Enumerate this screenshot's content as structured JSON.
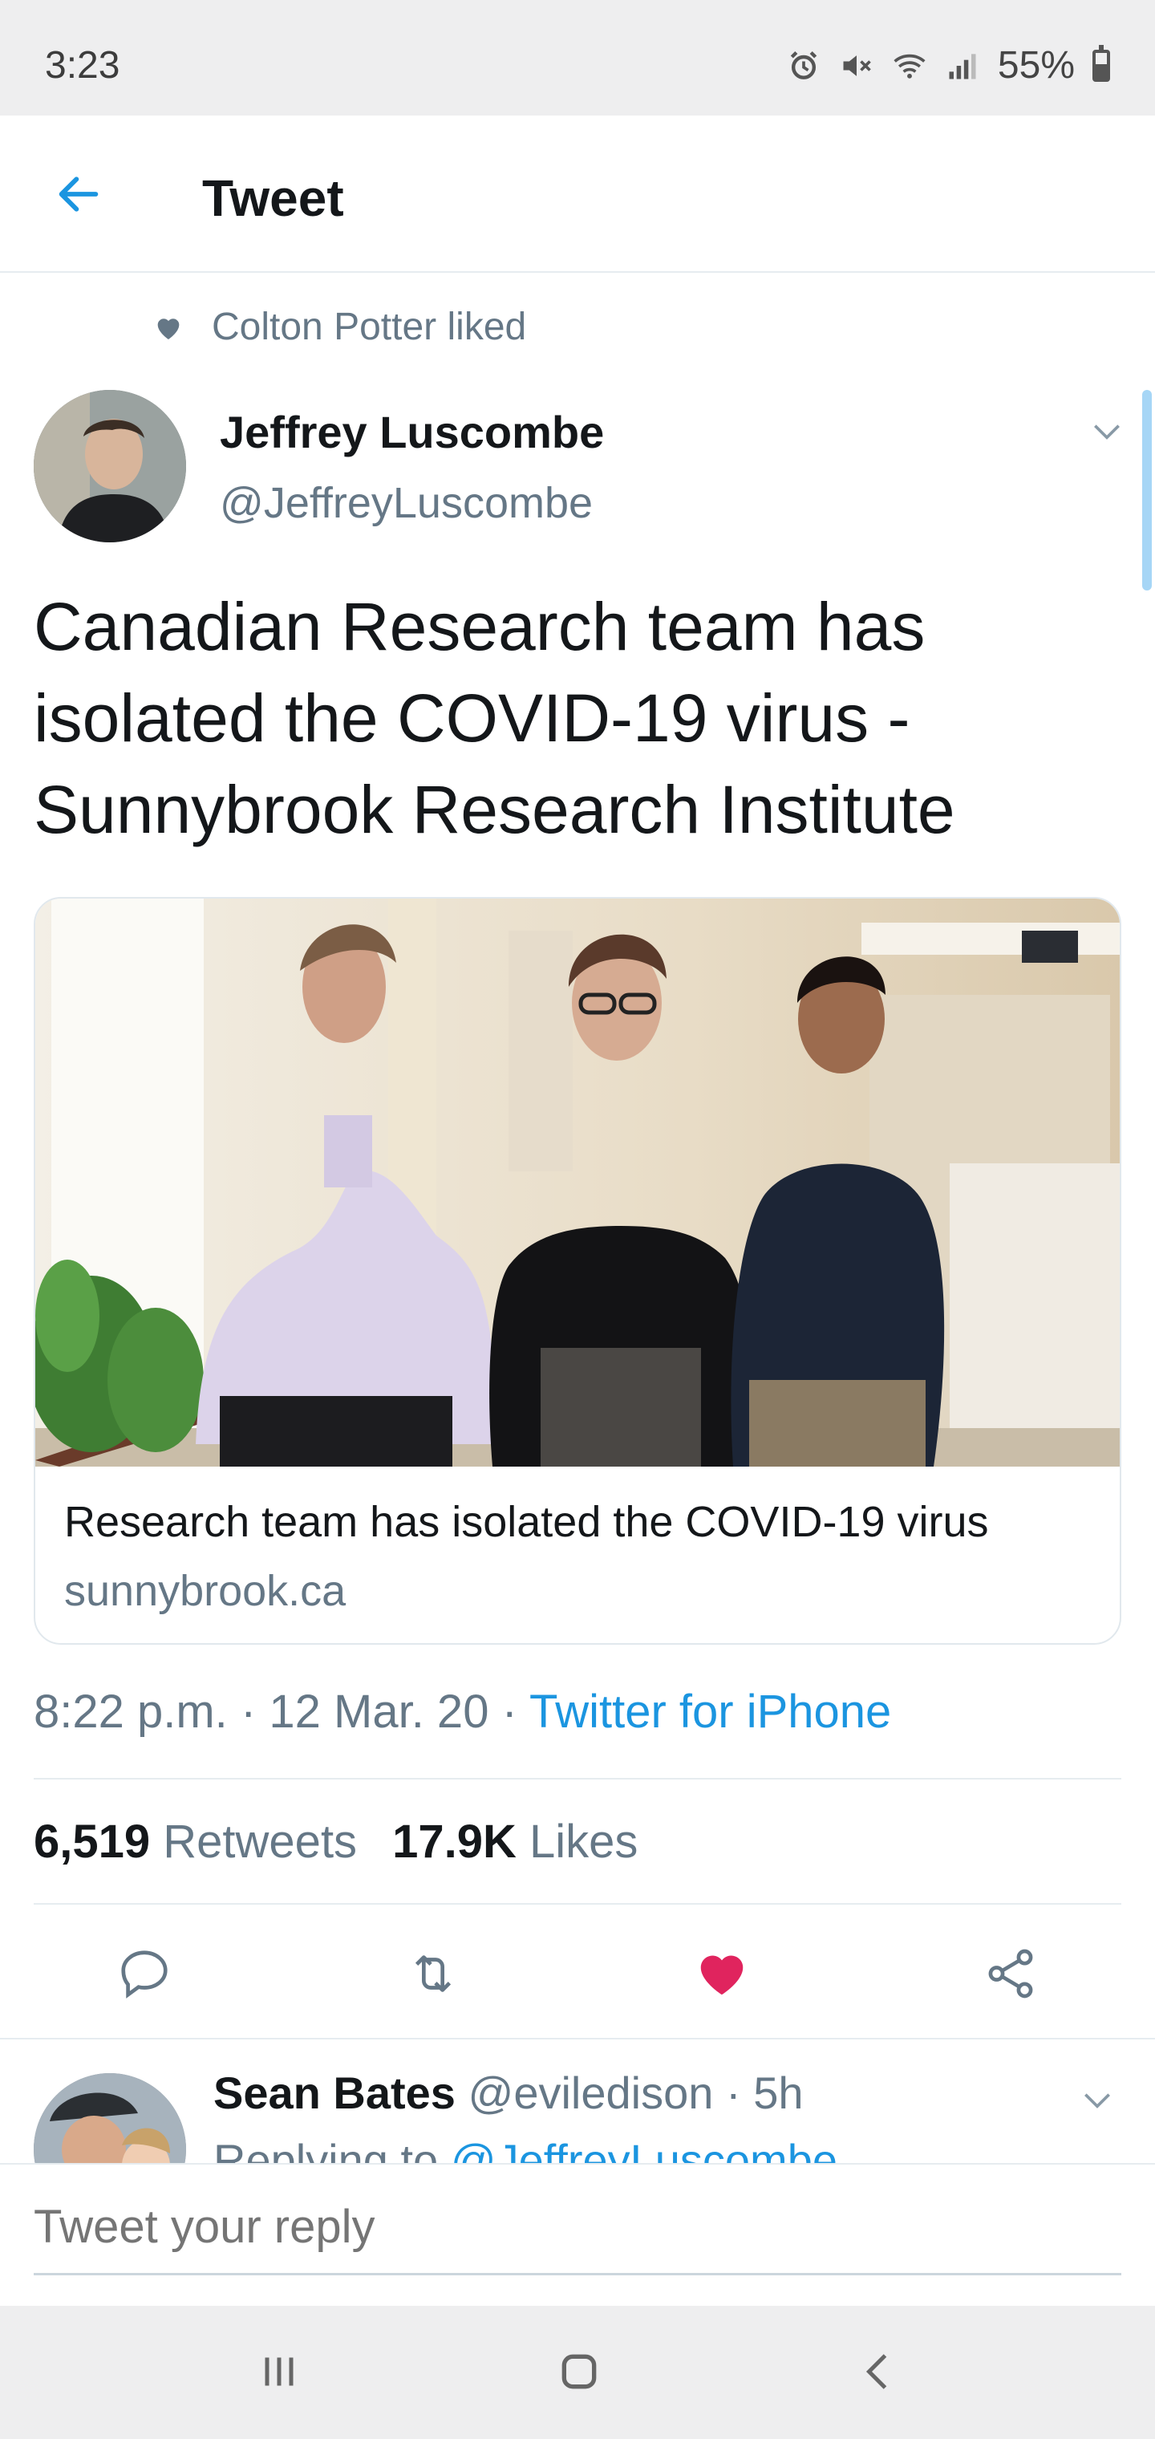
{
  "status_bar": {
    "time": "3:23",
    "battery": "55%",
    "battery_level": 0.55,
    "icons": [
      "alarm-icon",
      "mute-icon",
      "wifi-icon",
      "signal-icon",
      "battery-icon"
    ]
  },
  "header": {
    "title": "Tweet",
    "back_icon": "arrow-left-icon"
  },
  "social_context": {
    "text": "Colton Potter liked",
    "icon": "heart-icon"
  },
  "tweet": {
    "author_name": "Jeffrey Luscombe",
    "author_handle": "@JeffreyLuscombe",
    "text": "Canadian Research team has isolated the COVID-19 virus - Sunnybrook Research Institute",
    "card": {
      "title": "Research team has isolated the COVID-19 virus",
      "domain": "sunnybrook.ca"
    },
    "time": "8:22 p.m.",
    "date": "12 Mar. 20",
    "source": "Twitter for iPhone",
    "retweets_count": "6,519",
    "retweets_label": "Retweets",
    "likes_count": "17.9K",
    "likes_label": "Likes",
    "liked": true
  },
  "reply": {
    "author_name": "Sean Bates",
    "author_handle": "@eviledison",
    "age": "5h",
    "replying_prefix": "Replying to",
    "replying_to": "@JeffreyLuscombe"
  },
  "composer": {
    "placeholder": "Tweet your reply"
  },
  "colors": {
    "accent": "#1b95e0",
    "like": "#e0245e",
    "secondary_text": "#657786"
  }
}
